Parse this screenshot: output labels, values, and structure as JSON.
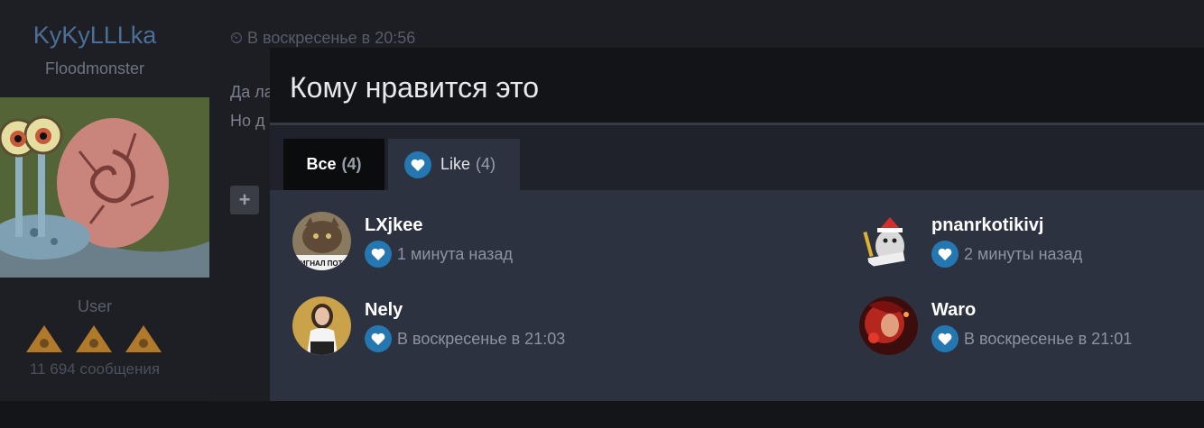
{
  "background_post": {
    "username": "KyKyLLLka",
    "user_title": "Floodmonster",
    "role": "User",
    "messages": "11 694 сообщения",
    "date": "В воскресенье в 20:56",
    "text_line1": "Да ла",
    "text_line2": "Но д",
    "plus": "+"
  },
  "dialog": {
    "title": "Кому нравится это",
    "tabs": [
      {
        "label": "Все",
        "count": "(4)",
        "active": true
      },
      {
        "label": "Like",
        "count": "(4)",
        "icon": "heart-icon",
        "active": false
      }
    ],
    "reactions": [
      {
        "name": "LXjkee",
        "time": "1 минута назад",
        "avatar_text": "СИГНАЛ ПОТЕ",
        "icon": "heart-icon"
      },
      {
        "name": "pnanrkotikivj",
        "time": "2 минуты назад",
        "icon": "heart-icon"
      },
      {
        "name": "Nely",
        "time": "В воскресенье в 21:03",
        "icon": "heart-icon"
      },
      {
        "name": "Waro",
        "time": "В воскресенье в 21:01",
        "icon": "heart-icon"
      }
    ]
  },
  "colors": {
    "accent_heart_bg": "#2577b1",
    "dialog_bg": "#2d3240",
    "header_bg": "#121418",
    "username_link": "#4c6f98"
  }
}
